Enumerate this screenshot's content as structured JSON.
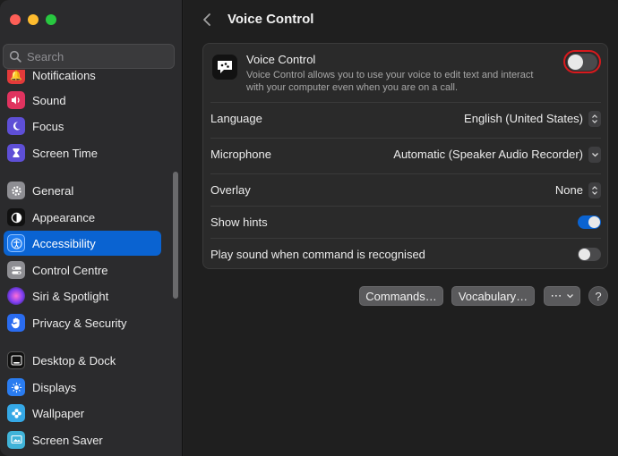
{
  "sidebar": {
    "search_placeholder": "Search",
    "items": [
      {
        "label": "Notifications",
        "icon": "bell-icon",
        "color": "#e33a3a"
      },
      {
        "label": "Sound",
        "icon": "speaker-icon",
        "color": "#e0335f"
      },
      {
        "label": "Focus",
        "icon": "moon-icon",
        "color": "#5e4fd6"
      },
      {
        "label": "Screen Time",
        "icon": "hourglass-icon",
        "color": "#5e4fd6"
      },
      {
        "label": "General",
        "icon": "gear-icon",
        "color": "#8e8e93"
      },
      {
        "label": "Appearance",
        "icon": "appearance-icon",
        "color": "#1a1a1a"
      },
      {
        "label": "Accessibility",
        "icon": "accessibility-icon",
        "color": "#1e7cf0"
      },
      {
        "label": "Control Centre",
        "icon": "control-centre-icon",
        "color": "#8e8e93"
      },
      {
        "label": "Siri & Spotlight",
        "icon": "siri-icon",
        "color": "#c23ad8"
      },
      {
        "label": "Privacy & Security",
        "icon": "hand-icon",
        "color": "#2a6cf0"
      },
      {
        "label": "Desktop & Dock",
        "icon": "dock-icon",
        "color": "#1a1a1a"
      },
      {
        "label": "Displays",
        "icon": "sun-icon",
        "color": "#2a7cf0"
      },
      {
        "label": "Wallpaper",
        "icon": "flower-icon",
        "color": "#35a8e6"
      },
      {
        "label": "Screen Saver",
        "icon": "screensaver-icon",
        "color": "#40b3d8"
      }
    ]
  },
  "header": {
    "title": "Voice Control"
  },
  "voice_control": {
    "title": "Voice Control",
    "description": "Voice Control allows you to use your voice to edit text and interact with your computer even when you are on a call.",
    "enabled": false
  },
  "settings": [
    {
      "label": "Language",
      "value": "English (United States)",
      "control": "stepper"
    },
    {
      "label": "Microphone",
      "value": "Automatic (Speaker Audio Recorder)",
      "control": "dropdown"
    },
    {
      "label": "Overlay",
      "value": "None",
      "control": "stepper"
    },
    {
      "label": "Show hints",
      "value": "",
      "control": "toggle-on"
    },
    {
      "label": "Play sound when command is recognised",
      "value": "",
      "control": "toggle-off"
    }
  ],
  "buttons": {
    "commands": "Commands…",
    "vocabulary": "Vocabulary…",
    "more": "⋯",
    "help": "?"
  },
  "colors": {
    "accent": "#0a63d1",
    "highlight_border": "#d8191d"
  }
}
